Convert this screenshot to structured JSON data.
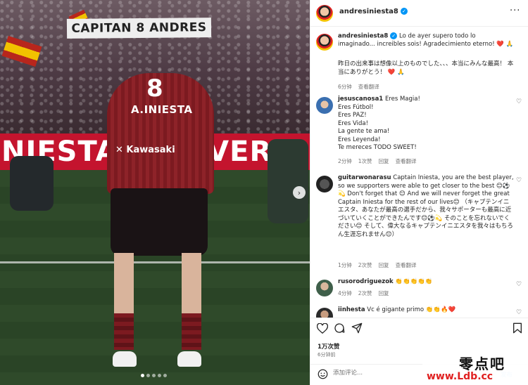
{
  "photo": {
    "banner_text": "CAPITAN 8 ANDRES",
    "ad_board_text": "NIESTA KOB    VER",
    "shirt_number": "8",
    "shirt_name": "A.INIESTA",
    "shirt_sponsor": "Kawasaki",
    "carousel_next": "›",
    "slide_count": 5,
    "active_slide": 1
  },
  "header": {
    "username": "andresiniesta8",
    "verified": "✓",
    "more": "···"
  },
  "caption": {
    "username": "andresiniesta8",
    "text_es": "Lo de ayer supero todo lo imaginado... increibles sois! Agradecimiento eterno! ❤️ 🙏",
    "text_ja": "昨日の出来事は想像以上のものでした、、、本当にみんな最高！ 本当にありがとう！ ❤️ 🙏",
    "time": "6分钟",
    "translate": "查看翻译"
  },
  "comments": [
    {
      "username": "jesuscanosa1",
      "lines": [
        "Eres Magia!",
        "Eres Fútbol!",
        "Eres PAZ!",
        "Eres Vida!",
        "La gente te ama!",
        "Eres Leyenda!",
        "Te mereces TODO SWEET!"
      ],
      "time": "2分钟",
      "likes": "1次赞",
      "reply": "回复",
      "translate": "查看翻译"
    },
    {
      "username": "guitarwonarasu",
      "text": "Captain Iniesta, you are the best player, so we supporters were able to get closer to the best 😊⚽ 💫 Don't forget that 😊 And we will never forget the great Captain Iniesta for the rest of our lives😊 （キャプテンイニエスタ、あなたが最高の選手だから、我々サポーターも最高に近づいていくことができたんです😊⚽💫 そのことを忘れないでください😊 そして、偉大なるキャプテンイニエスタを我々はもちろん生涯忘れません😊）",
      "time": "1分钟",
      "likes": "2次赞",
      "reply": "回复",
      "translate": "查看翻译"
    },
    {
      "username": "rusorodriguezok",
      "text": "👏👏👏👏👏",
      "time": "4分钟",
      "likes": "2次赞",
      "reply": "回复"
    },
    {
      "username": "iinhesta",
      "text": "Vc é gigante primo 👏👏🔥❤️"
    }
  ],
  "footer": {
    "likes": "1万次赞",
    "time": "6分钟前",
    "add_comment_placeholder": "添加评论...",
    "post_label": "发布"
  },
  "watermark": {
    "chinese": "零点吧",
    "url": "www.Ldb.cc"
  },
  "colors": {
    "verified_blue": "#0095f6",
    "heart_red": "#ed4956",
    "meta_gray": "#737373",
    "jersey_red": "#8e2329"
  }
}
